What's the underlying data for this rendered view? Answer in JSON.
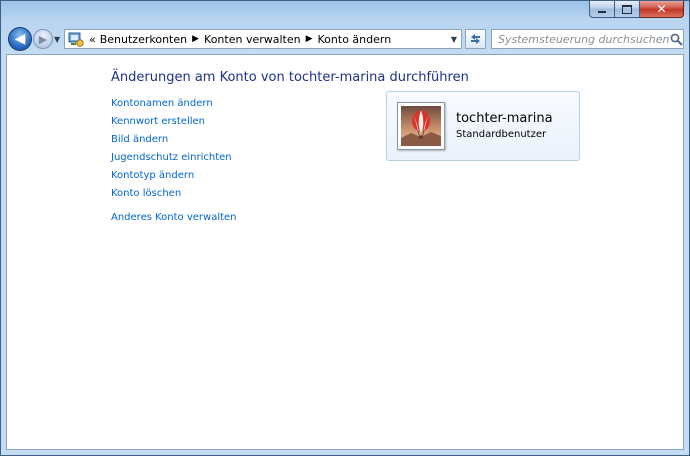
{
  "window": {
    "close_glyph": "✕"
  },
  "navigation": {
    "back_glyph": "◀",
    "forward_glyph": "▶",
    "breadcrumbs": [
      {
        "label": "Benutzerkonten"
      },
      {
        "label": "Konten verwalten"
      },
      {
        "label": "Konto ändern"
      }
    ],
    "overflow_glyph": "«",
    "address_icon": "control-panel-icon",
    "search_placeholder": "Systemsteuerung durchsuchen"
  },
  "main": {
    "title": "Änderungen am Konto von tochter-marina durchführen",
    "tasks": [
      {
        "label": "Kontonamen ändern"
      },
      {
        "label": "Kennwort erstellen"
      },
      {
        "label": "Bild ändern"
      },
      {
        "label": "Jugendschutz einrichten"
      },
      {
        "label": "Kontotyp ändern"
      },
      {
        "label": "Konto löschen"
      }
    ],
    "other_link": "Anderes Konto verwalten"
  },
  "account": {
    "name": "tochter-marina",
    "type": "Standardbenutzer",
    "picture": "hot-air-balloon-avatar"
  },
  "colors": {
    "link": "#0066cc",
    "title": "#1e3287",
    "frame": "#c3dcf3",
    "close_button": "#c1341f"
  }
}
